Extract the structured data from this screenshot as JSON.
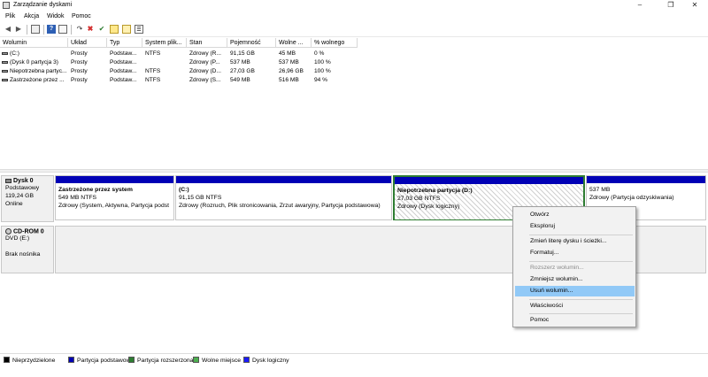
{
  "window": {
    "title": "Zarządzanie dyskami",
    "min": "–",
    "max": "❐",
    "close": "✕"
  },
  "menu": [
    "Plik",
    "Akcja",
    "Widok",
    "Pomoc"
  ],
  "toolbar": [
    "back-icon",
    "forward-icon",
    "console-icon",
    "help-icon",
    "properties-icon",
    "connect-icon",
    "delete-icon",
    "check-icon",
    "new-icon",
    "import-icon",
    "list-icon"
  ],
  "table": {
    "headers": [
      "Wolumin",
      "Układ",
      "Typ",
      "System plik...",
      "Stan",
      "Pojemność",
      "Wolne ...",
      "% wolnego"
    ],
    "rows": [
      [
        "(C:)",
        "Prosty",
        "Podstaw...",
        "NTFS",
        "Zdrowy (R...",
        "91,15 GB",
        "45 MB",
        "0 %"
      ],
      [
        "(Dysk 0 partycja 3)",
        "Prosty",
        "Podstaw...",
        "",
        "Zdrowy (P...",
        "537 MB",
        "537 MB",
        "100 %"
      ],
      [
        "Niepotrzebna partyc...",
        "Prosty",
        "Podstaw...",
        "NTFS",
        "Zdrowy (D...",
        "27,03 GB",
        "26,96 GB",
        "100 %"
      ],
      [
        "Zastrzeżone przez ...",
        "Prosty",
        "Podstaw...",
        "NTFS",
        "Zdrowy (S...",
        "549 MB",
        "516 MB",
        "94 %"
      ]
    ]
  },
  "disk0": {
    "name": "Dysk 0",
    "lines": [
      "Podstawowy",
      "119,24 GB",
      "Online"
    ],
    "partitions": [
      {
        "title": "Zastrzeżone przez system",
        "size": "549 MB NTFS",
        "status": "Zdrowy (System, Aktywna, Partycja podst"
      },
      {
        "title": "(C:)",
        "size": "91,15 GB NTFS",
        "status": "Zdrowy (Rozruch, Plik stronicowania, Zrzut awaryjny, Partycja podstawowa)"
      },
      {
        "title": "Niepotrzebna partycja  (D:)",
        "size": "27,03 GB NTFS",
        "status": "Zdrowy (Dysk logiczny)"
      },
      {
        "title": "",
        "size": "537 MB",
        "status": "Zdrowy (Partycja odzyskiwania)"
      }
    ]
  },
  "cdrom0": {
    "name": "CD-ROM 0",
    "lines": [
      "DVD (E:)",
      "",
      "Brak nośnika"
    ]
  },
  "legend": [
    {
      "label": "Nieprzydzielone",
      "color": "#000000"
    },
    {
      "label": "Partycja podstawowa",
      "color": "#0000b5"
    },
    {
      "label": "Partycja rozszerzona",
      "color": "#2e7d32"
    },
    {
      "label": "Wolne miejsce",
      "color": "#4caf50"
    },
    {
      "label": "Dysk logiczny",
      "color": "#1a1aff"
    }
  ],
  "context_menu": {
    "items": [
      {
        "label": "Otwórz",
        "disabled": false
      },
      {
        "label": "Eksploruj",
        "disabled": false
      },
      {
        "label": "Zmień literę dysku i ścieżki...",
        "disabled": false
      },
      {
        "label": "Formatuj...",
        "disabled": false
      },
      {
        "label": "Rozszerz wolumin...",
        "disabled": true
      },
      {
        "label": "Zmniejsz wolumin...",
        "disabled": false
      },
      {
        "label": "Usuń wolumin...",
        "disabled": false,
        "highlighted": true
      },
      {
        "label": "Właściwości",
        "disabled": false
      },
      {
        "label": "Pomoc",
        "disabled": false
      }
    ]
  }
}
